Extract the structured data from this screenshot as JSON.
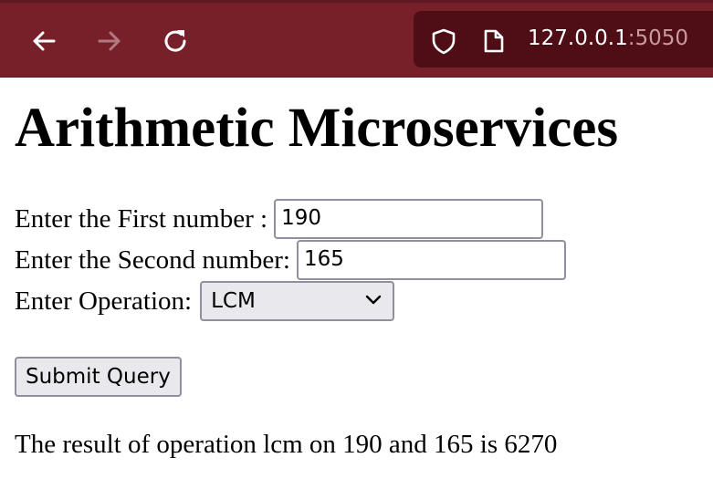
{
  "browser": {
    "url_host": "127.0.0.1",
    "url_port": ":5050",
    "back_icon": "arrow-left-icon",
    "forward_icon": "arrow-right-icon",
    "reload_icon": "reload-icon",
    "shield_icon": "shield-icon",
    "page_icon": "page-icon",
    "bar_color": "#77202a",
    "url_bg_color": "#4f0e16"
  },
  "page": {
    "title": "Arithmetic Microservices",
    "first_label": "Enter the First number :",
    "first_value": "190",
    "second_label": "Enter the Second number:",
    "second_value": "165",
    "operation_label": "Enter Operation:",
    "operation_selected": "LCM",
    "submit_label": "Submit Query",
    "result_text": "The result of operation lcm on 190 and 165 is 6270"
  }
}
